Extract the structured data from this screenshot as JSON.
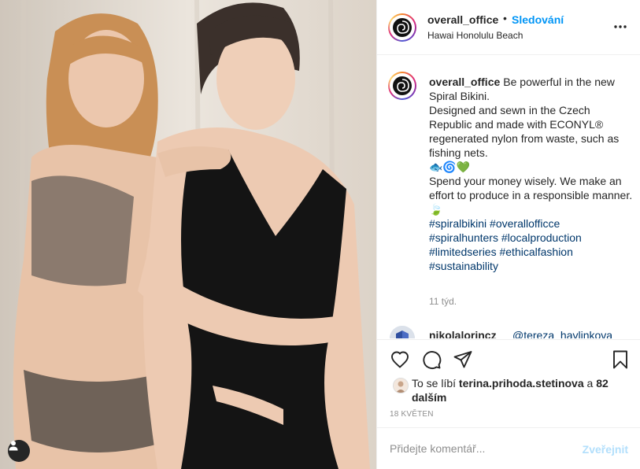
{
  "post": {
    "author": "overall_office",
    "follow_label": "Sledování",
    "dot": "•",
    "location": "Hawai Honolulu Beach",
    "more_icon": "more-dots-icon"
  },
  "caption": {
    "username": "overall_office",
    "lines": [
      "Be powerful in the new Spiral Bikini.",
      "Designed and sewn in the Czech Republic and made with ECONYL® regenerated nylon from waste, such as fishing nets.",
      "🐟🌀💚",
      "Spend your money wisely. We make an effort to produce in a responsible manner.",
      "🍃"
    ],
    "hashtags": [
      [
        "#spiralbikini",
        "#overallofficce"
      ],
      [
        "#spiralhunters",
        "#localproduction"
      ],
      [
        "#limitedseries",
        "#ethicalfashion"
      ],
      [
        "#sustainability"
      ]
    ],
    "time_ago": "11 týd."
  },
  "comment_preview": {
    "username": "nikolalorincz",
    "mention": "@tereza_havlinkova"
  },
  "actions": {
    "like_icon": "heart-icon",
    "comment_icon": "comment-bubble-icon",
    "share_icon": "paper-plane-icon",
    "save_icon": "bookmark-icon"
  },
  "likes": {
    "prefix": "To se líbí",
    "user": "terina.prihoda.stetinova",
    "connector": "a",
    "others": "82 dalším"
  },
  "date": "18 KVĚTEN",
  "comment_box": {
    "placeholder": "Přidejte komentář...",
    "post_label": "Zveřejnit"
  },
  "colors": {
    "accent": "#0095f6",
    "hashtag": "#00376b",
    "muted": "#8e8e8e",
    "post_disabled": "#b2dffc"
  }
}
